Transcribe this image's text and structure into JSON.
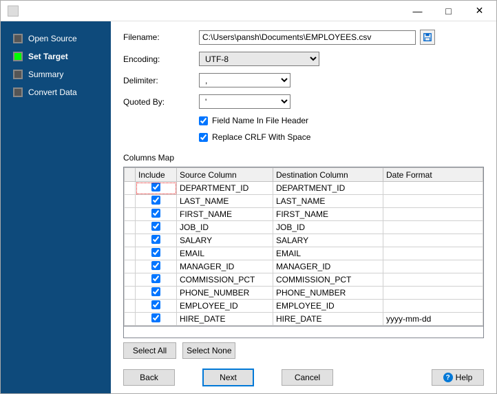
{
  "titlebar": {
    "min": "—",
    "max": "□",
    "close": "✕"
  },
  "sidebar": {
    "steps": [
      {
        "label": "Open Source",
        "active": false
      },
      {
        "label": "Set Target",
        "active": true
      },
      {
        "label": "Summary",
        "active": false
      },
      {
        "label": "Convert Data",
        "active": false
      }
    ]
  },
  "form": {
    "filename_label": "Filename:",
    "filename_value": "C:\\Users\\pansh\\Documents\\EMPLOYEES.csv",
    "encoding_label": "Encoding:",
    "encoding_value": "UTF-8",
    "delimiter_label": "Delimiter:",
    "delimiter_value": ",",
    "quoted_label": "Quoted By:",
    "quoted_value": "'",
    "chk_header": "Field Name In File Header",
    "chk_crlf": "Replace CRLF With Space"
  },
  "columns": {
    "title": "Columns Map",
    "headers": {
      "include": "Include",
      "source": "Source Column",
      "dest": "Destination Column",
      "dateformat": "Date Format"
    },
    "rows": [
      {
        "include": true,
        "source": "DEPARTMENT_ID",
        "dest": "DEPARTMENT_ID",
        "dateformat": ""
      },
      {
        "include": true,
        "source": "LAST_NAME",
        "dest": "LAST_NAME",
        "dateformat": ""
      },
      {
        "include": true,
        "source": "FIRST_NAME",
        "dest": "FIRST_NAME",
        "dateformat": ""
      },
      {
        "include": true,
        "source": "JOB_ID",
        "dest": "JOB_ID",
        "dateformat": ""
      },
      {
        "include": true,
        "source": "SALARY",
        "dest": "SALARY",
        "dateformat": ""
      },
      {
        "include": true,
        "source": "EMAIL",
        "dest": "EMAIL",
        "dateformat": ""
      },
      {
        "include": true,
        "source": "MANAGER_ID",
        "dest": "MANAGER_ID",
        "dateformat": ""
      },
      {
        "include": true,
        "source": "COMMISSION_PCT",
        "dest": "COMMISSION_PCT",
        "dateformat": ""
      },
      {
        "include": true,
        "source": "PHONE_NUMBER",
        "dest": "PHONE_NUMBER",
        "dateformat": ""
      },
      {
        "include": true,
        "source": "EMPLOYEE_ID",
        "dest": "EMPLOYEE_ID",
        "dateformat": ""
      },
      {
        "include": true,
        "source": "HIRE_DATE",
        "dest": "HIRE_DATE",
        "dateformat": "yyyy-mm-dd"
      }
    ]
  },
  "buttons": {
    "select_all": "Select All",
    "select_none": "Select None",
    "back": "Back",
    "next": "Next",
    "cancel": "Cancel",
    "help": "Help"
  }
}
